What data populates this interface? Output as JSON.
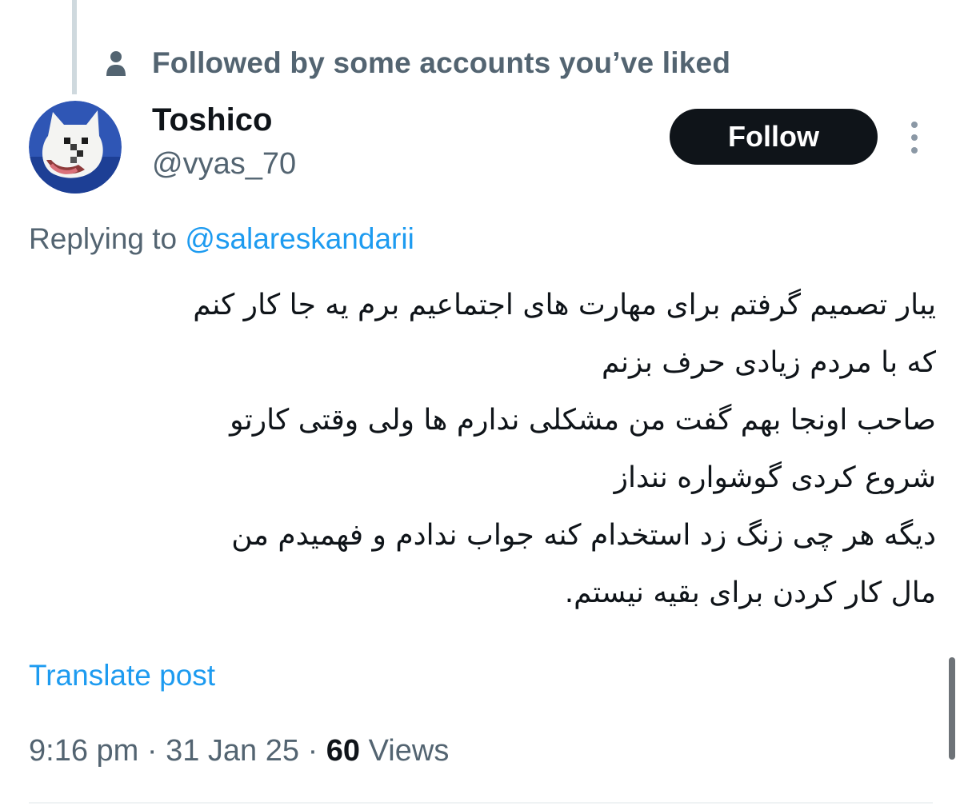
{
  "social_context": {
    "icon": "person-icon",
    "text": "Followed by some accounts you’ve liked"
  },
  "user": {
    "avatar": "dog-avatar",
    "display_name": "Toshico",
    "handle": "@vyas_70"
  },
  "actions": {
    "follow_label": "Follow",
    "more_icon": "more-vertical-icon"
  },
  "reply": {
    "prefix": "Replying to ",
    "mention": "@salareskandarii"
  },
  "post": {
    "lines": [
      "یبار تصمیم گرفتم برای مهارت های اجتماعیم برم یه جا کار کنم",
      "که با مردم زیادی حرف بزنم",
      "صاحب اونجا بهم گفت من مشکلی ندارم ها ولی وقتی کارتو",
      "شروع کردی گوشواره ننداز",
      "دیگه هر چی زنگ زد استخدام کنه جواب ندادم و فهمیدم من",
      "مال کار کردن برای بقیه نیستم."
    ],
    "translate_label": "Translate post"
  },
  "meta": {
    "time": "9:16 pm",
    "separator": " · ",
    "date": "31 Jan 25",
    "views_count": "60",
    "views_label": " Views"
  },
  "colors": {
    "secondary_text": "#536471",
    "link": "#1d9bf0",
    "button_bg": "#0f1419",
    "thread_line": "#cfd9de"
  }
}
